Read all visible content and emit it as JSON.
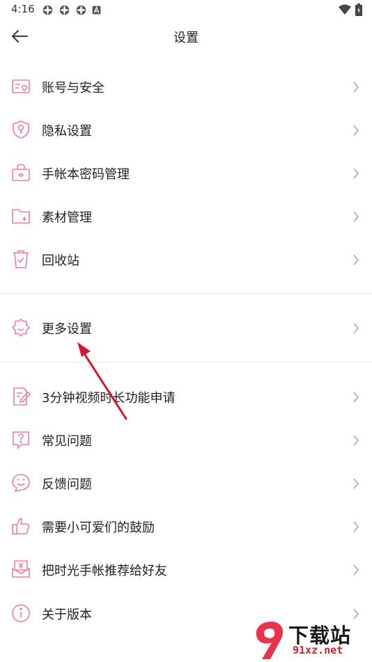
{
  "status_bar": {
    "time": "4:16"
  },
  "header": {
    "title": "设置"
  },
  "colors": {
    "icon_pink": "#f07ca0",
    "chevron": "#a8a8a8",
    "arrow_red": "#d3172b",
    "divider": "#e6e6e6"
  },
  "groups": [
    [
      {
        "label": "账号与安全",
        "icon": "account-security-icon"
      },
      {
        "label": "隐私设置",
        "icon": "privacy-shield-icon"
      },
      {
        "label": "手帐本密码管理",
        "icon": "password-lock-icon"
      },
      {
        "label": "素材管理",
        "icon": "folder-icon"
      },
      {
        "label": "回收站",
        "icon": "recycle-bin-icon"
      }
    ],
    [
      {
        "label": "更多设置",
        "icon": "gear-icon"
      }
    ],
    [
      {
        "label": "3分钟视频时长功能申请",
        "icon": "edit-document-icon"
      },
      {
        "label": "常见问题",
        "icon": "faq-icon"
      },
      {
        "label": "反馈问题",
        "icon": "feedback-smile-icon"
      },
      {
        "label": "需要小可爱们的鼓励",
        "icon": "thumbs-up-icon"
      },
      {
        "label": "把时光手帐推荐给好友",
        "icon": "gift-recommend-icon"
      },
      {
        "label": "关于版本",
        "icon": "info-icon"
      }
    ]
  ],
  "watermark": {
    "brand": "下载站",
    "url": "91xz.net",
    "logo_text": "9"
  }
}
